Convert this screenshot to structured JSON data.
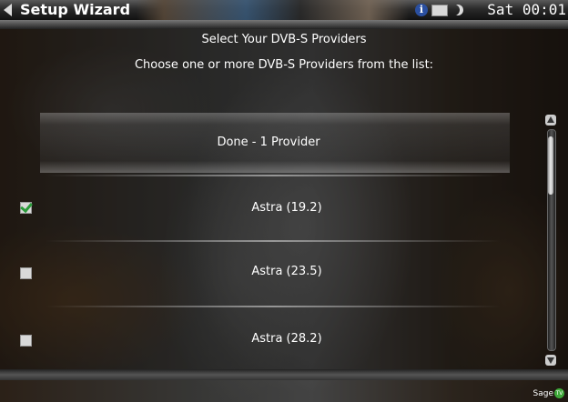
{
  "header": {
    "title": "Setup Wizard",
    "clock": "Sat 00:01",
    "icons": [
      "back-arrow-icon",
      "info-icon",
      "mail-icon",
      "moon-icon"
    ]
  },
  "page": {
    "heading": "Select Your DVB-S Providers",
    "subheading": "Choose one or more DVB-S Providers from the list:"
  },
  "list": {
    "done_label": "Done - 1 Provider",
    "items": [
      {
        "label": "Astra (19.2)",
        "checked": true
      },
      {
        "label": "Astra (23.5)",
        "checked": false
      },
      {
        "label": "Astra (28.2)",
        "checked": false
      }
    ]
  },
  "footer": {
    "logo_text": "Sage",
    "logo_badge": "TV"
  },
  "colors": {
    "check_green": "#2b9b3a",
    "info_blue": "#2a4fa0",
    "logo_green": "#3fa83a"
  }
}
